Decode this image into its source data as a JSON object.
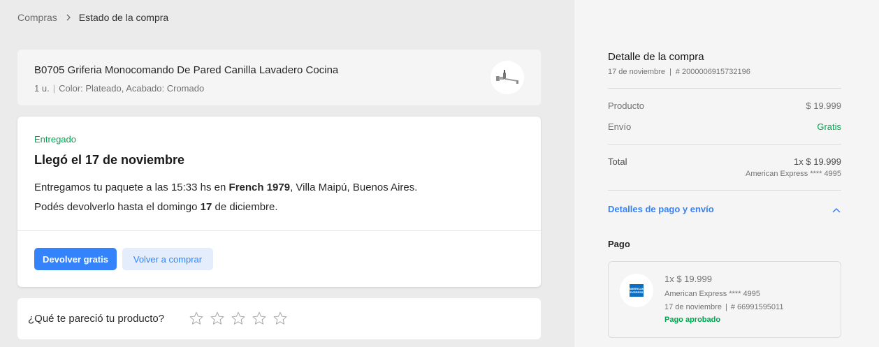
{
  "breadcrumb": {
    "parent": "Compras",
    "current": "Estado de la compra"
  },
  "product": {
    "title": "B0705 Griferia Monocomando De Pared Canilla Lavadero Cocina",
    "quantity": "1 u.",
    "attributes": "Color: Plateado, Acabado: Cromado",
    "thumbnail_icon": "faucet-icon"
  },
  "status": {
    "label": "Entregado",
    "title": "Llegó el 17 de noviembre",
    "line1": {
      "prefix": "Entregamos tu paquete a las 15:33 hs en ",
      "address_bold": "French 1979",
      "suffix": ", Villa Maipú, Buenos Aires."
    },
    "line2": {
      "prefix": "Podés devolverlo hasta el domingo ",
      "day_bold": "17",
      "suffix": " de diciembre."
    },
    "primary_button": "Devolver gratis",
    "secondary_button": "Volver a comprar"
  },
  "rating": {
    "question": "¿Qué te pareció tu producto?",
    "stars_total": 5,
    "stars_filled": 0
  },
  "summary": {
    "title": "Detalle de la compra",
    "date": "17 de noviembre",
    "order_number": "# 2000006915732196",
    "product_label": "Producto",
    "product_value": "$ 19.999",
    "shipping_label": "Envío",
    "shipping_value": "Gratis",
    "total_label": "Total",
    "total_value": "1x $ 19.999",
    "total_payment_method": "American Express **** 4995",
    "details_toggle": "Detalles de pago y envío"
  },
  "payment": {
    "section_title": "Pago",
    "amount": "1x $ 19.999",
    "card": "American Express **** 4995",
    "date": "17 de noviembre",
    "operation_number": "# 66991595011",
    "status": "Pago aprobado",
    "logo_icon": "amex-icon"
  },
  "colors": {
    "accent": "#3483fa",
    "success": "#00a650",
    "background": "#ebebeb"
  }
}
